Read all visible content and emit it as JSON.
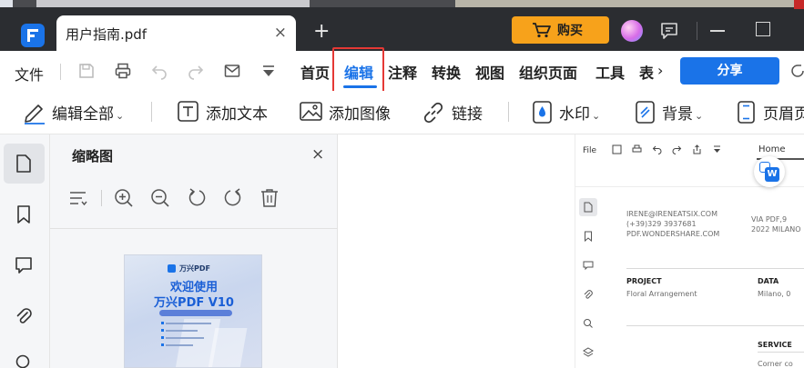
{
  "colors": {
    "titlebar_bg": "#2b2d31",
    "accent": "#1a73e8",
    "buy_button": "#f7a21b",
    "highlight_box": "#e53935"
  },
  "titlebar": {
    "tab_title": "用户指南.pdf",
    "tab_close": "×",
    "new_tab": "+",
    "buy_label": "购买"
  },
  "menubar": {
    "file_label": "文件",
    "tabs": [
      "首页",
      "编辑",
      "注释",
      "转换",
      "视图",
      "组织页面",
      "工具",
      "表"
    ],
    "active_tab": "编辑",
    "more": "›",
    "share_label": "分享"
  },
  "toolbar": {
    "edit_all": "编辑全部",
    "add_text": "添加文本",
    "add_image": "添加图像",
    "link": "链接",
    "watermark": "水印",
    "background": "背景",
    "header_footer": "页眉页",
    "caret": "⌄"
  },
  "thumbnail_panel": {
    "title": "缩略图",
    "close": "×",
    "page": {
      "brand": "万兴PDF",
      "heading_line1": "欢迎使用",
      "heading_line2": "万兴PDF V10"
    }
  },
  "preview": {
    "file_label": "File",
    "home_label": "Home",
    "email": "IRENE@IRENEATSIX.COM",
    "phone": "(+39)329 3937681",
    "website": "PDF.WONDERSHARE.COM",
    "address1": "VIA PDF,9",
    "address2": "2022 MILANO",
    "project_label": "PROJECT",
    "project_value": "Floral Arrangement",
    "data_label": "DATA",
    "data_value": "Milano, 0",
    "service_label": "SERVICE",
    "service_value": "Corner co"
  }
}
